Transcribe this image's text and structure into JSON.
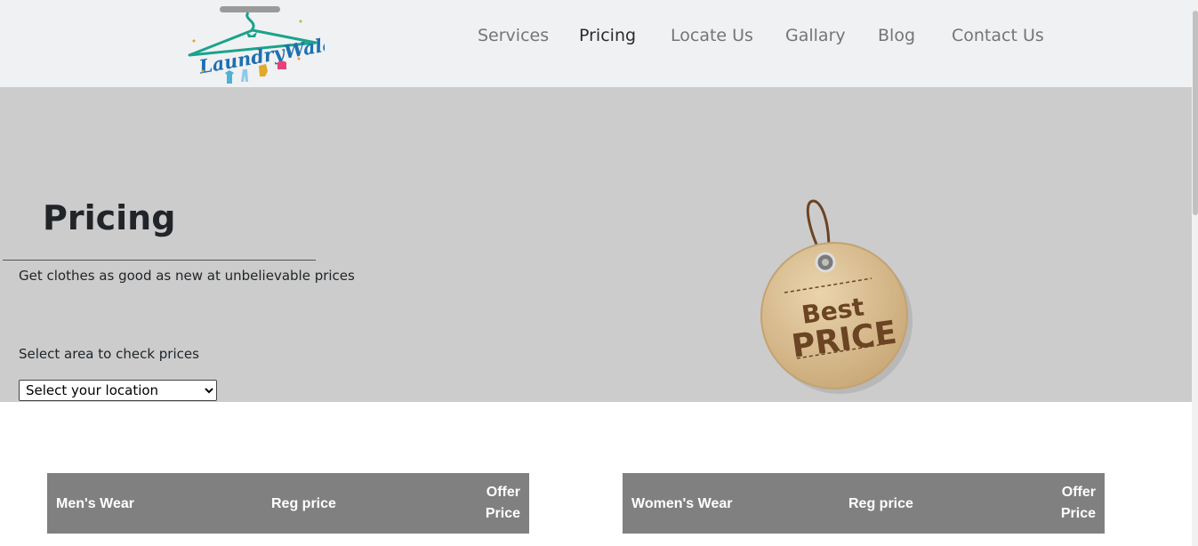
{
  "brand": {
    "logo_text": "LaundryWalaa"
  },
  "nav": {
    "items": [
      {
        "label": "Services"
      },
      {
        "label": "Pricing"
      },
      {
        "label": "Locate Us"
      },
      {
        "label": "Gallary"
      },
      {
        "label": "Blog"
      },
      {
        "label": "Contact Us"
      }
    ],
    "active": "Pricing"
  },
  "hero": {
    "title": "Pricing",
    "subtitle": "Get clothes as good as new at unbelievable prices",
    "area_label": "Select area to check prices",
    "location_select": {
      "selected": "Select your location"
    },
    "badge": {
      "line1": "Best",
      "line2": "PRICE"
    }
  },
  "tables": {
    "mens": {
      "col1": "Men's Wear",
      "col2": "Reg price",
      "col3_line1": "Offer",
      "col3_line2": "Price"
    },
    "womens": {
      "col1": "Women's Wear",
      "col2": "Reg price",
      "col3_line1": "Offer",
      "col3_line2": "Price"
    }
  },
  "colors": {
    "header_bg": "#f0f1f3",
    "hero_bg": "#cccccc",
    "table_header_bg": "#808080",
    "logo_teal": "#1aa38c",
    "logo_blue": "#1e6fb0",
    "badge_tan": "#d8bd92",
    "badge_brown": "#6b4424"
  }
}
